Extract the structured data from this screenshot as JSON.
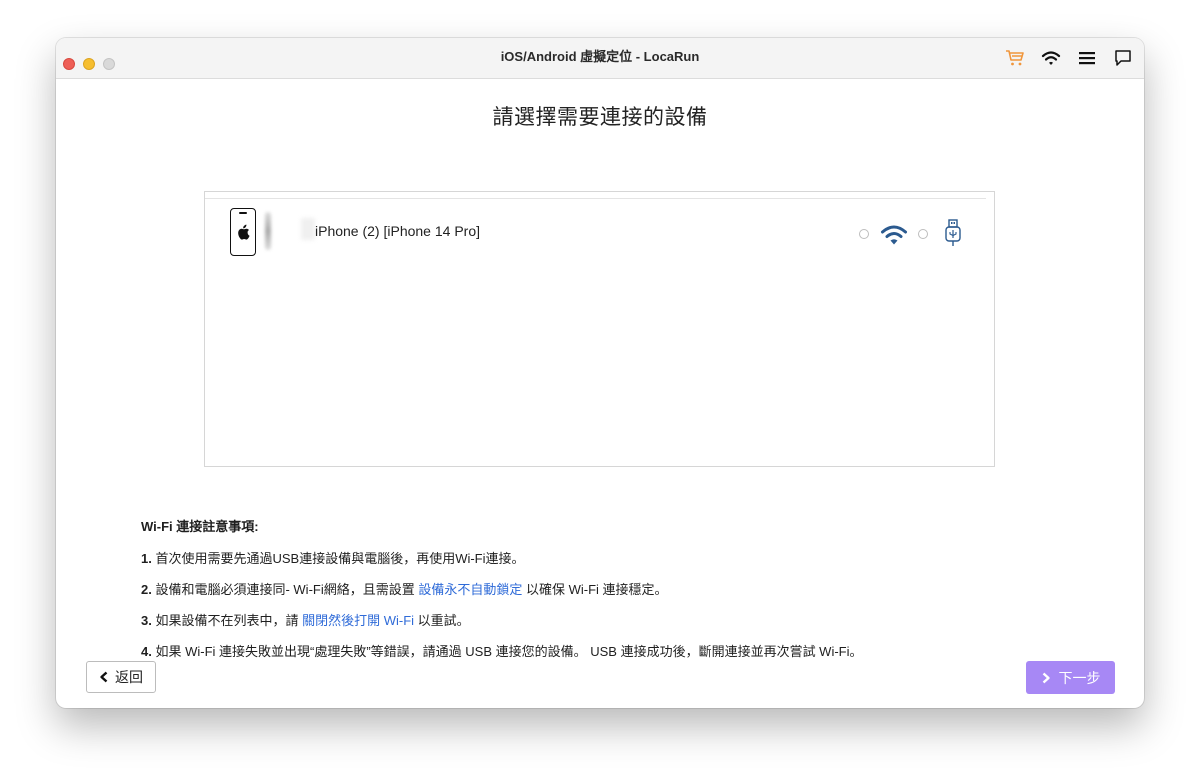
{
  "window": {
    "title": "iOS/Android 虛擬定位 - LocaRun"
  },
  "toolbar": {
    "icons": [
      "cart-icon",
      "wifi-icon",
      "menu-icon",
      "feedback-icon"
    ],
    "cart_color": "#f0963c"
  },
  "page": {
    "title": "請選擇需要連接的設備"
  },
  "devices": [
    {
      "name": "iPhone (2) [iPhone 14 Pro]",
      "icon": "apple-phone-icon",
      "connection_options": [
        "wifi",
        "usb"
      ],
      "selected_connection": "none"
    }
  ],
  "notes": {
    "title": "Wi-Fi 連接註意事項:",
    "items": [
      {
        "num": "1.",
        "text": "首次使用需要先通過USB連接設備與電腦後，再使用Wi-Fi連接。"
      },
      {
        "num": "2.",
        "text_before": "設備和電腦必須連接同- Wi-Fi網絡，且需設置",
        "link": "設備永不自動鎖定",
        "text_after": "以確保 Wi-Fi 連接穩定。"
      },
      {
        "num": "3.",
        "text_before": "如果設備不在列表中，請",
        "link": "關閉然後打開 Wi-Fi",
        "text_after": "以重試。"
      },
      {
        "num": "4.",
        "text": "如果 Wi-Fi 連接失敗並出現“處理失敗”等錯誤，請通過 USB 連接您的設備。 USB 連接成功後，斷開連接並再次嘗試 Wi-Fi。"
      }
    ]
  },
  "buttons": {
    "back_label": "返回",
    "next_label": "下一步",
    "next_color": "#a788f5",
    "link_color": "#2f6bd8",
    "wifi_icon_color": "#2b5a8f"
  }
}
